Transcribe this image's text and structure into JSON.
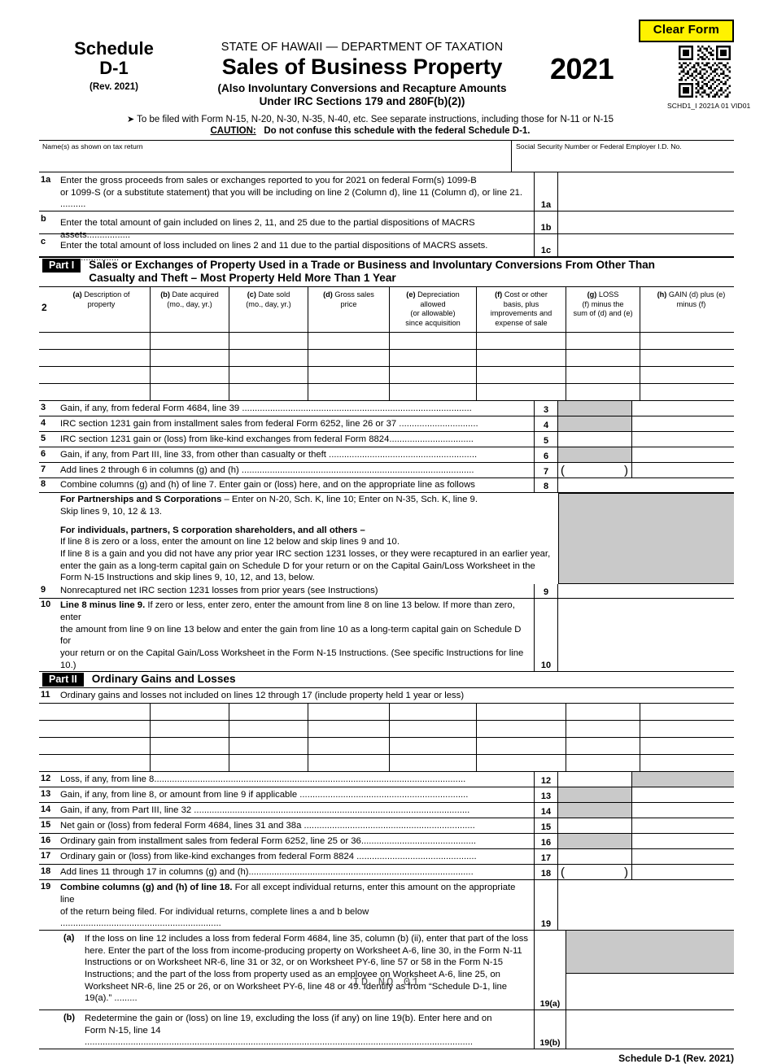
{
  "header": {
    "clear_form_label": "Clear Form",
    "clear_form_bg": "#FFF200",
    "schedule_line1": "Schedule",
    "schedule_line2": "D-1",
    "schedule_rev": "(Rev. 2021)",
    "state_line": "STATE OF HAWAII — DEPARTMENT OF TAXATION",
    "main_title": "Sales of Business Property",
    "subtitle_line1": "(Also Involuntary Conversions and Recapture Amounts",
    "subtitle_line2": "Under IRC Sections 179 and 280F(b)(2))",
    "year": "2021",
    "vid": "SCHD1_I 2021A 01 VID01",
    "filed_with": "To be filed with Form N-15, N-20, N-30, N-35, N-40, etc. See separate instructions, including those for N-11 or N-15",
    "caution_label": "CAUTION:",
    "caution_text": "Do not confuse this schedule with the federal Schedule D-1."
  },
  "namebar": {
    "name_label": "Name(s) as shown on tax return",
    "ssn_label": "Social Security Number or Federal Employer I.D. No.",
    "name_value": "",
    "ssn_value": ""
  },
  "lines_1": [
    {
      "num": "1a",
      "boxnum": "1a",
      "text_line1": "Enter the gross proceeds from sales or exchanges reported to you for 2021 on federal Form(s) 1099-B",
      "text_line2": "or 1099-S (or a substitute statement) that you will be including on line 2 (Column d), line 11 (Column d), or line 21. ..........",
      "value": ""
    },
    {
      "num": "b",
      "boxnum": "1b",
      "text_line1": "Enter the total amount of gain included on lines 2, 11, and 25 due to the partial dispositions of MACRS assets.................",
      "text_line2": "",
      "value": ""
    },
    {
      "num": "c",
      "boxnum": "1c",
      "text_line1": "Enter the total amount of loss included on lines 2 and 11 due to the partial dispositions of MACRS assets. .......................",
      "text_line2": "",
      "value": ""
    }
  ],
  "part1": {
    "tag": "Part I",
    "title_line1": "Sales or Exchanges of Property Used in a Trade or Business and Involuntary Conversions From Other Than",
    "title_line2": "Casualty and Theft – Most Property Held More Than 1 Year",
    "line_number": "2",
    "columns": [
      {
        "key": "a",
        "tag": "(a)",
        "l1": "Description of",
        "l2": "property",
        "l3": "",
        "l4": ""
      },
      {
        "key": "b",
        "tag": "(b)",
        "l1": "Date acquired",
        "l2": "(mo., day, yr.)",
        "l3": "",
        "l4": ""
      },
      {
        "key": "c",
        "tag": "(c)",
        "l1": "Date sold",
        "l2": "(mo., day, yr.)",
        "l3": "",
        "l4": ""
      },
      {
        "key": "d",
        "tag": "(d)",
        "l1": "Gross sales",
        "l2": "price",
        "l3": "",
        "l4": ""
      },
      {
        "key": "e",
        "tag": "(e)",
        "l1": "Depreciation",
        "l2": "allowed",
        "l3": "(or allowable)",
        "l4": "since acquisition"
      },
      {
        "key": "f",
        "tag": "(f)",
        "l1": "Cost or other",
        "l2": "basis, plus",
        "l3": "improvements and",
        "l4": "expense of sale"
      },
      {
        "key": "g",
        "tag": "(g)",
        "l1": "LOSS",
        "l2": "(f) minus the",
        "l3": "sum of (d) and (e)",
        "l4": ""
      },
      {
        "key": "h",
        "tag": "(h)",
        "l1": "GAIN (d) plus (e)",
        "l2": "minus (f)",
        "l3": "",
        "l4": ""
      }
    ],
    "rows": [
      {
        "a": "",
        "b": "",
        "c": "",
        "d": "",
        "e": "",
        "f": "",
        "g": "",
        "h": ""
      },
      {
        "a": "",
        "b": "",
        "c": "",
        "d": "",
        "e": "",
        "f": "",
        "g": "",
        "h": ""
      },
      {
        "a": "",
        "b": "",
        "c": "",
        "d": "",
        "e": "",
        "f": "",
        "g": "",
        "h": ""
      },
      {
        "a": "",
        "b": "",
        "c": "",
        "d": "",
        "e": "",
        "f": "",
        "g": "",
        "h": ""
      }
    ],
    "lines": [
      {
        "num": "3",
        "boxnum": "3",
        "text": "Gain, if any, from federal Form 4684, line 39 ..........................................................................................",
        "g_shaded": true,
        "h_shaded": false,
        "paren": false,
        "g": "",
        "h": ""
      },
      {
        "num": "4",
        "boxnum": "4",
        "text": "IRC section 1231 gain from installment sales from federal Form 6252, line 26 or 37 ...............................",
        "g_shaded": true,
        "h_shaded": false,
        "paren": false,
        "g": "",
        "h": ""
      },
      {
        "num": "5",
        "boxnum": "5",
        "text": "IRC section 1231 gain or (loss) from like-kind exchanges from federal Form 8824.................................",
        "g_shaded": false,
        "h_shaded": false,
        "paren": false,
        "g": "",
        "h": ""
      },
      {
        "num": "6",
        "boxnum": "6",
        "text": "Gain, if any, from Part III, line 33, from other than casualty or theft ..........................................................",
        "g_shaded": true,
        "h_shaded": false,
        "paren": false,
        "g": "",
        "h": ""
      },
      {
        "num": "7",
        "boxnum": "7",
        "text": "Add lines 2 through 6 in columns (g) and (h) ...........................................................................................",
        "g_shaded": false,
        "h_shaded": false,
        "paren": true,
        "g": "",
        "h": ""
      }
    ],
    "line8": {
      "num": "8",
      "boxnum": "8",
      "intro": "Combine columns (g) and (h) of line 7.  Enter gain or (loss) here, and on the appropriate line as follows",
      "value": "",
      "para1_bold": "For Partnerships and S Corporations",
      "para1_rest": " – Enter on N-20, Sch. K, line 10; Enter on N-35, Sch. K, line 9.",
      "para1_line2": "Skip lines  9, 10, 12 & 13.",
      "para2_bold": "For individuals, partners, S corporation shareholders, and all others –",
      "para2_l1": "If line 8 is zero or a loss, enter the amount on line 12 below and skip lines 9 and 10.",
      "para2_l2": "If line 8 is a gain and you did not have any prior year IRC section 1231 losses, or they were recaptured in an earlier year,",
      "para2_l3": "enter the gain as a long-term capital gain on Schedule D for your return or on the Capital Gain/Loss Worksheet in the",
      "para2_l4": "Form N-15 Instructions and skip lines 9, 10, 12, and 13, below."
    },
    "line9": {
      "num": "9",
      "boxnum": "9",
      "text": "Nonrecaptured net IRC section 1231 losses from prior years (see Instructions)",
      "value": ""
    },
    "line10": {
      "num": "10",
      "boxnum": "10",
      "bold": "Line 8 minus line 9.",
      "l1_rest": "  If zero or less, enter zero, enter the amount from line 8 on line 13 below.  If more than zero, enter",
      "l2": "the amount from line 9 on line 13 below and enter the gain from line 10 as a long-term capital gain on Schedule D for",
      "l3": "your return or on the Capital Gain/Loss Worksheet in the Form N-15 Instructions.  (See specific Instructions for line 10.)",
      "value": ""
    }
  },
  "part2": {
    "tag": "Part II",
    "title": "Ordinary Gains and Losses",
    "line11": {
      "num": "11",
      "text": "Ordinary gains and losses not included on lines 12 through 17 (include property held 1 year or less)"
    },
    "rows": [
      {
        "a": "",
        "b": "",
        "c": "",
        "d": "",
        "e": "",
        "f": "",
        "g": "",
        "h": ""
      },
      {
        "a": "",
        "b": "",
        "c": "",
        "d": "",
        "e": "",
        "f": "",
        "g": "",
        "h": ""
      },
      {
        "a": "",
        "b": "",
        "c": "",
        "d": "",
        "e": "",
        "f": "",
        "g": "",
        "h": ""
      },
      {
        "a": "",
        "b": "",
        "c": "",
        "d": "",
        "e": "",
        "f": "",
        "g": "",
        "h": ""
      }
    ],
    "lines": [
      {
        "num": "12",
        "boxnum": "12",
        "text": "Loss, if any, from line 8..........................................................................................................................",
        "g_shaded": false,
        "h_shaded": true,
        "paren": false,
        "g": "",
        "h": ""
      },
      {
        "num": "13",
        "boxnum": "13",
        "text": "Gain, if any, from line 8, or amount from line 9 if applicable  ..................................................................",
        "g_shaded": true,
        "h_shaded": false,
        "paren": false,
        "g": "",
        "h": ""
      },
      {
        "num": "14",
        "boxnum": "14",
        "text": "Gain, if any, from Part III, line 32 ............................................................................................................",
        "g_shaded": true,
        "h_shaded": false,
        "paren": false,
        "g": "",
        "h": ""
      },
      {
        "num": "15",
        "boxnum": "15",
        "text": "Net gain or (loss) from federal Form 4684, lines 31 and 38a ...................................................................",
        "g_shaded": false,
        "h_shaded": false,
        "paren": false,
        "g": "",
        "h": ""
      },
      {
        "num": "16",
        "boxnum": "16",
        "text": "Ordinary gain from installment sales from federal Form 6252, line 25 or 36.............................................",
        "g_shaded": true,
        "h_shaded": false,
        "paren": false,
        "g": "",
        "h": ""
      },
      {
        "num": "17",
        "boxnum": "17",
        "text": "Ordinary gain or (loss) from like-kind exchanges from federal Form 8824 ...............................................",
        "g_shaded": false,
        "h_shaded": false,
        "paren": false,
        "g": "",
        "h": ""
      },
      {
        "num": "18",
        "boxnum": "18",
        "text": "Add lines 11 through 17 in columns (g) and (h)........................................................................................",
        "g_shaded": false,
        "h_shaded": false,
        "paren": true,
        "g": "",
        "h": ""
      }
    ],
    "line19": {
      "num": "19",
      "boxnum": "19",
      "bold": "Combine columns (g) and (h) of line 18.",
      "l1_rest": " For all except individual returns, enter this amount on the appropriate line",
      "l2": "of the return being filed. For individual returns, complete lines a and b below ...............................................................",
      "value": ""
    },
    "line19a": {
      "tag": "(a)",
      "boxnum": "19(a)",
      "l1": "If the loss on line 12 includes a loss from federal Form 4684, line 35, column (b) (ii), enter that part of the loss",
      "l2": "here. Enter the part of the loss from income-producing property on Worksheet A-6, line 30, in the Form N-11",
      "l3": "Instructions or on Worksheet NR-6, line 31 or 32, or on Worksheet PY-6, line 57 or 58 in the Form N-15",
      "l4": "Instructions; and the part of the loss from property used as an employee on Worksheet A-6, line 25, on",
      "l5": "Worksheet NR-6, line 25 or 26, or on Worksheet PY-6, line 48 or 49.  Identify as from “Schedule D-1, line 19(a).” .........",
      "value": ""
    },
    "line19b": {
      "tag": "(b)",
      "boxnum": "19(b)",
      "l1": "Redetermine the gain or (loss) on line 19, excluding the loss (if any) on line 19(b).  Enter here and on",
      "l2": "Form N-15, line 14 ........................................................................................................................................................",
      "value": ""
    }
  },
  "footer": {
    "right_label": "Schedule D-1 (Rev. 2021)",
    "bottom_id": "ID NO 01"
  }
}
